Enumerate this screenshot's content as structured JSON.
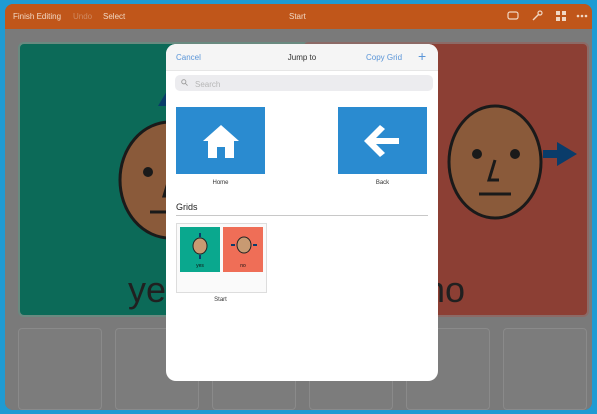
{
  "topbar": {
    "finish_editing": "Finish Editing",
    "undo": "Undo",
    "select": "Select",
    "title": "Start"
  },
  "background_grid": {
    "left_label": "ye",
    "right_label": "no"
  },
  "dialog": {
    "cancel_label": "Cancel",
    "title": "Jump to",
    "copy_grid_label": "Copy Grid",
    "add_symbol": "+",
    "search_placeholder": "Search",
    "tiles": [
      {
        "label": "Home",
        "icon": "home-icon"
      },
      {
        "label": "Back",
        "icon": "back-arrow-icon"
      }
    ],
    "grids_heading": "Grids",
    "grid_items": [
      {
        "label": "Start",
        "thumb_left_label": "yes",
        "thumb_right_label": "no"
      }
    ]
  },
  "colors": {
    "accent_bar": "#c0561a",
    "tile_blue": "#2a8bd0",
    "link_blue": "#5a95d8",
    "frame_border": "#1f9bd3"
  }
}
